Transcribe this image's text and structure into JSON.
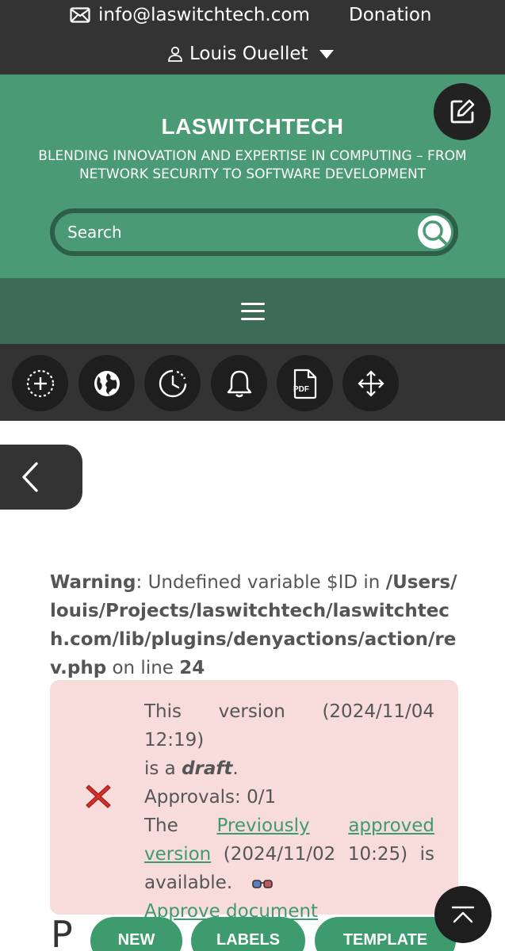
{
  "topbar": {
    "email": "info@laswitchtech.com",
    "donation": "Donation",
    "user": "Louis Ouellet"
  },
  "header": {
    "title": "LASWITCHTECH",
    "tagline": "BLENDING INNOVATION AND EXPERTISE IN COMPUTING – FROM NETWORK SECURITY TO SOFTWARE DEVELOPMENT"
  },
  "search": {
    "placeholder": "Search"
  },
  "toolbar": {
    "pdf_label": "PDF"
  },
  "warning": {
    "label": "Warning",
    "message": ": Undefined variable $ID in ",
    "path": "/Users/louis/Projects/laswitchtech/laswitchtech.com/lib/plugins/denyactions/action/rev.php",
    "on_line": " on line ",
    "line": "24"
  },
  "notice": {
    "line1": "This version (2024/11/04 12:19)",
    "line2_prefix": "is a ",
    "line2_status": "draft",
    "line2_suffix": ".",
    "approvals": "Approvals: 0/1",
    "the": "The",
    "prev_link_a": "Previously",
    "prev_link_b": "approved",
    "prev_link_c": "version",
    "prev_date": "(2024/11/02 10:25)",
    "is_word": "is",
    "available": "available.",
    "approve_link": "Approve document"
  },
  "bottom": {
    "p_glyph": "P",
    "new_label": "NEW",
    "labels_label": "LABELS",
    "template_label": "TEMPLATE"
  },
  "colors": {
    "topbar": "#333333",
    "header_green": "#4a9a75",
    "nav_green": "#3d6b55",
    "accent": "#3d9b6e",
    "notice_bg": "#f8dcdc"
  }
}
